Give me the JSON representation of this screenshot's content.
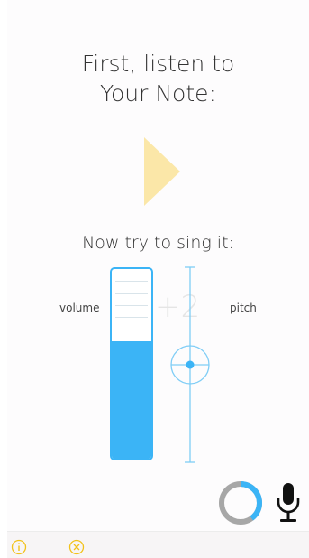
{
  "heading": {
    "line1": "First, listen to",
    "line2": "Your Note:"
  },
  "play_button": {
    "icon": "play-triangle-icon",
    "color": "#fbe7a8"
  },
  "subheading": "Now try to sing it:",
  "volume": {
    "label": "volume",
    "level": 0.62,
    "tick_count": 5,
    "color": "#3bb4f6"
  },
  "pitch": {
    "label": "pitch",
    "offset_text": "+2",
    "position": 0.5,
    "color": "#3bb4f6"
  },
  "progress_ring": {
    "progress": 0.4,
    "progress_color": "#3bb4f6",
    "track_color": "#a7a7a7"
  },
  "mic_button": {
    "icon": "microphone-icon"
  },
  "bottom_bar": {
    "info_icon": "info-icon",
    "close_icon": "close-circle-icon",
    "icon_color": "#f2c21b"
  }
}
